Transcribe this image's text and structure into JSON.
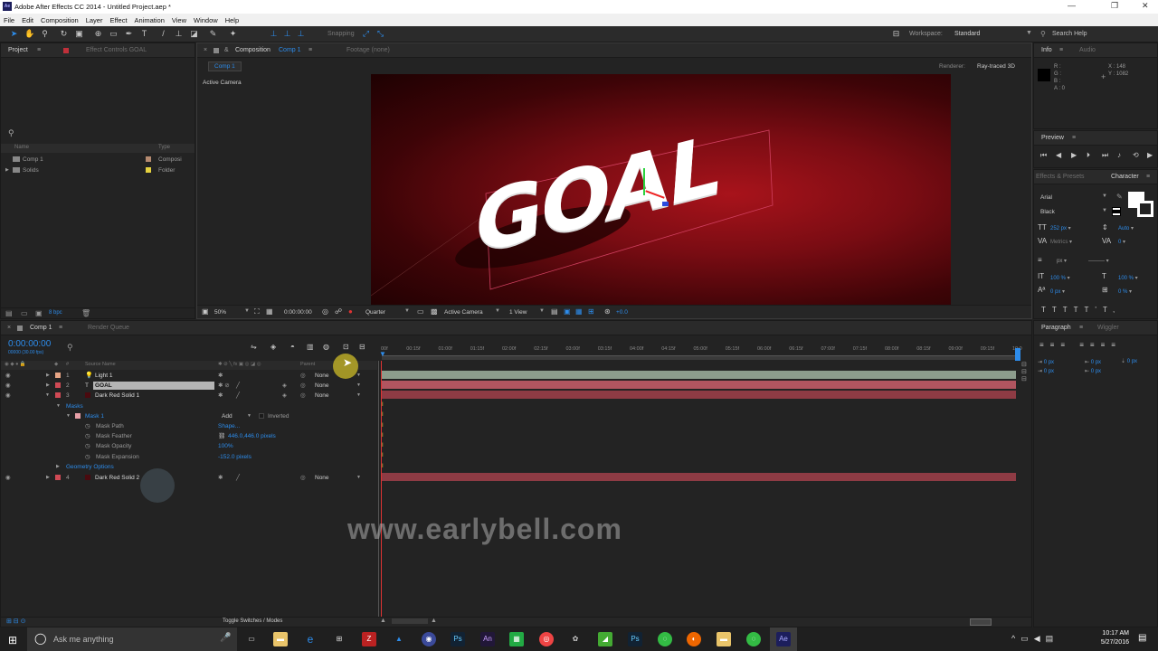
{
  "window": {
    "title": "Adobe After Effects CC 2014 - Untitled Project.aep *",
    "app_icon": "Ae"
  },
  "menu": [
    "File",
    "Edit",
    "Composition",
    "Layer",
    "Effect",
    "Animation",
    "View",
    "Window",
    "Help"
  ],
  "toolbar": {
    "snapping": "Snapping",
    "workspace_label": "Workspace:",
    "workspace_value": "Standard",
    "search": "Search Help"
  },
  "project": {
    "tab_project": "Project",
    "tab_effects": "Effect Controls GOAL",
    "col_name": "Name",
    "col_type": "Type",
    "items": [
      {
        "name": "Comp 1",
        "type": "Composi"
      },
      {
        "name": "Solids",
        "type": "Folder"
      }
    ],
    "bpc": "8 bpc"
  },
  "comp": {
    "tab_label": "Composition",
    "tab_comp": "Comp 1",
    "footage": "Footage (none)",
    "comp_chip": "Comp 1",
    "renderer_label": "Renderer:",
    "renderer_value": "Ray-traced 3D",
    "camera_label": "Active Camera",
    "text": "GOAL",
    "zoom": "50%",
    "timecode": "0:00:00:00",
    "resolution": "Quarter",
    "camera_select": "Active Camera",
    "views": "1 View",
    "exposure": "+0.0"
  },
  "info": {
    "tab_info": "Info",
    "tab_audio": "Audio",
    "r": "R :",
    "g": "G :",
    "b": "B :",
    "a": "A : 0",
    "x": "X : 148",
    "y": "Y : 1082"
  },
  "preview": {
    "tab": "Preview"
  },
  "character": {
    "tab_effects": "Effects & Presets",
    "tab_character": "Character",
    "font": "Arial",
    "style": "Black",
    "size": "252 px",
    "leading": "Auto",
    "kerning": "Metrics",
    "tracking": "0",
    "stroke": "px",
    "vscale": "100 %",
    "hscale": "100 %",
    "baseline": "0 px",
    "tsume": "0 %"
  },
  "paragraph": {
    "tab": "Paragraph",
    "tab_wiggler": "Wiggler",
    "v1": "0 px",
    "v2": "0 px",
    "v3": "0 px",
    "v4": "0 px",
    "v5": "0 px"
  },
  "timeline": {
    "tab_comp": "Comp 1",
    "tab_render": "Render Queue",
    "timecode": "0:00:00:00",
    "fps": "00000 (30.00 fps)",
    "col_source": "Source Name",
    "col_parent": "Parent",
    "ruler": [
      "00f",
      "00:15f",
      "01:00f",
      "01:15f",
      "02:00f",
      "02:15f",
      "03:00f",
      "03:15f",
      "04:00f",
      "04:15f",
      "05:00f",
      "05:15f",
      "06:00f",
      "06:15f",
      "07:00f",
      "07:15f",
      "08:00f",
      "08:15f",
      "09:00f",
      "09:15f",
      "10:0"
    ],
    "layers": [
      {
        "num": "1",
        "name": "Light 1",
        "parent": "None"
      },
      {
        "num": "2",
        "name": "GOAL",
        "parent": "None"
      },
      {
        "num": "3",
        "name": "Dark Red Solid 1",
        "parent": "None"
      },
      {
        "num": "4",
        "name": "Dark Red Solid 2",
        "parent": "None"
      }
    ],
    "masks_label": "Masks",
    "mask1": "Mask 1",
    "mask_mode": "Add",
    "inverted": "Inverted",
    "props": [
      {
        "name": "Mask Path",
        "value": "Shape..."
      },
      {
        "name": "Mask Feather",
        "value": "446.0,446.0 pixels"
      },
      {
        "name": "Mask Opacity",
        "value": "100%"
      },
      {
        "name": "Mask Expansion",
        "value": "-152.0 pixels"
      }
    ],
    "geometry": "Geometry Options",
    "toggle": "Toggle Switches / Modes"
  },
  "watermark": "www.earlybell.com",
  "taskbar": {
    "search": "Ask me anything",
    "time": "10:17 AM",
    "date": "5/27/2016"
  }
}
